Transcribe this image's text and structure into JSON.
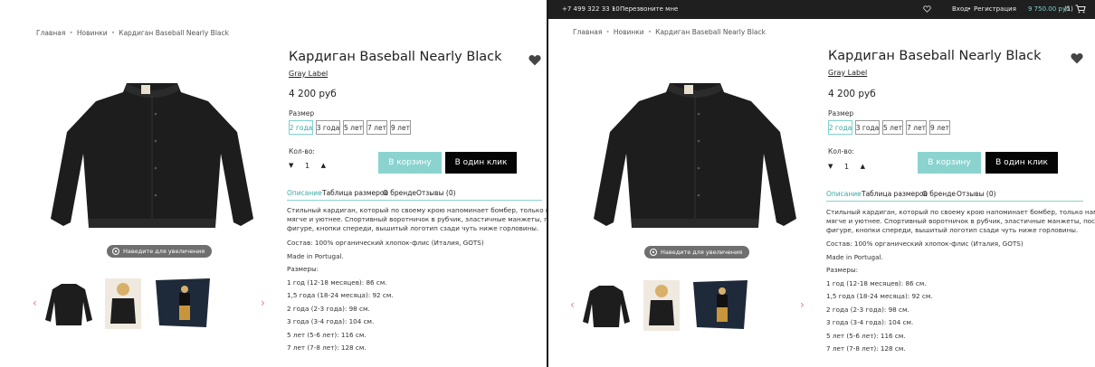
{
  "topbar": {
    "phone": "+7 499 322 33 10",
    "callback": "Перезвоните мне",
    "login": "Вход",
    "register": "Регистрация",
    "cart_price": "9 750.00 руб",
    "cart_count": "(1)",
    "sep": "•",
    "login_sep": "•"
  },
  "breadcrumb": {
    "items": [
      "Главная",
      "Новинки",
      "Кардиган Baseball Nearly Black"
    ],
    "sep": "•"
  },
  "product": {
    "title": "Кардиган Baseball Nearly Black",
    "brand": "Gray Label",
    "price": "4 200 руб",
    "size_label": "Размер",
    "sizes": [
      "2 года",
      "3 года",
      "5 лет",
      "7 лет",
      "9 лет"
    ],
    "selected_size_index": 0,
    "qty_label": "Кол-во:",
    "qty_value": "1",
    "qty_down": "▼",
    "qty_up": "▲",
    "add_to_cart": "В корзину",
    "one_click": "В один клик"
  },
  "tabs": [
    "Описание",
    "Таблица размеров",
    "О бренде",
    "Отзывы (0)"
  ],
  "description": [
    "Стильный кардиган, который по своему крою напоминает бомбер, только намного",
    "мягче и уютнее. Спортивный воротничок в рубчик, эластичные манжеты, посадка по",
    "фигуре, кнопки спереди, вышитый логотип сзади чуть ниже горловины.",
    "Состав: 100% органический хлопок-флис (Италия, GOTS)",
    "Made in Portugal.",
    "Размеры:",
    "1 год (12-18 месяцев): 86 см.",
    "1,5 года (18-24 месяца): 92 см.",
    "2 года (2-3 года): 98 см.",
    "3 года (3-4 года): 104 см.",
    "5 лет (5-6 лет): 116 см.",
    "7 лет (7-8 лет): 128 см."
  ],
  "gallery": {
    "zoom_hint": "Наведите для увеличения",
    "prev": "‹",
    "next": "›"
  },
  "colors": {
    "accent": "#8ad3cf",
    "accent_text": "#3aa8a4",
    "dark_button": "#050505",
    "topbar_bg": "#1f1f1f",
    "arrow": "#e07a8a"
  }
}
